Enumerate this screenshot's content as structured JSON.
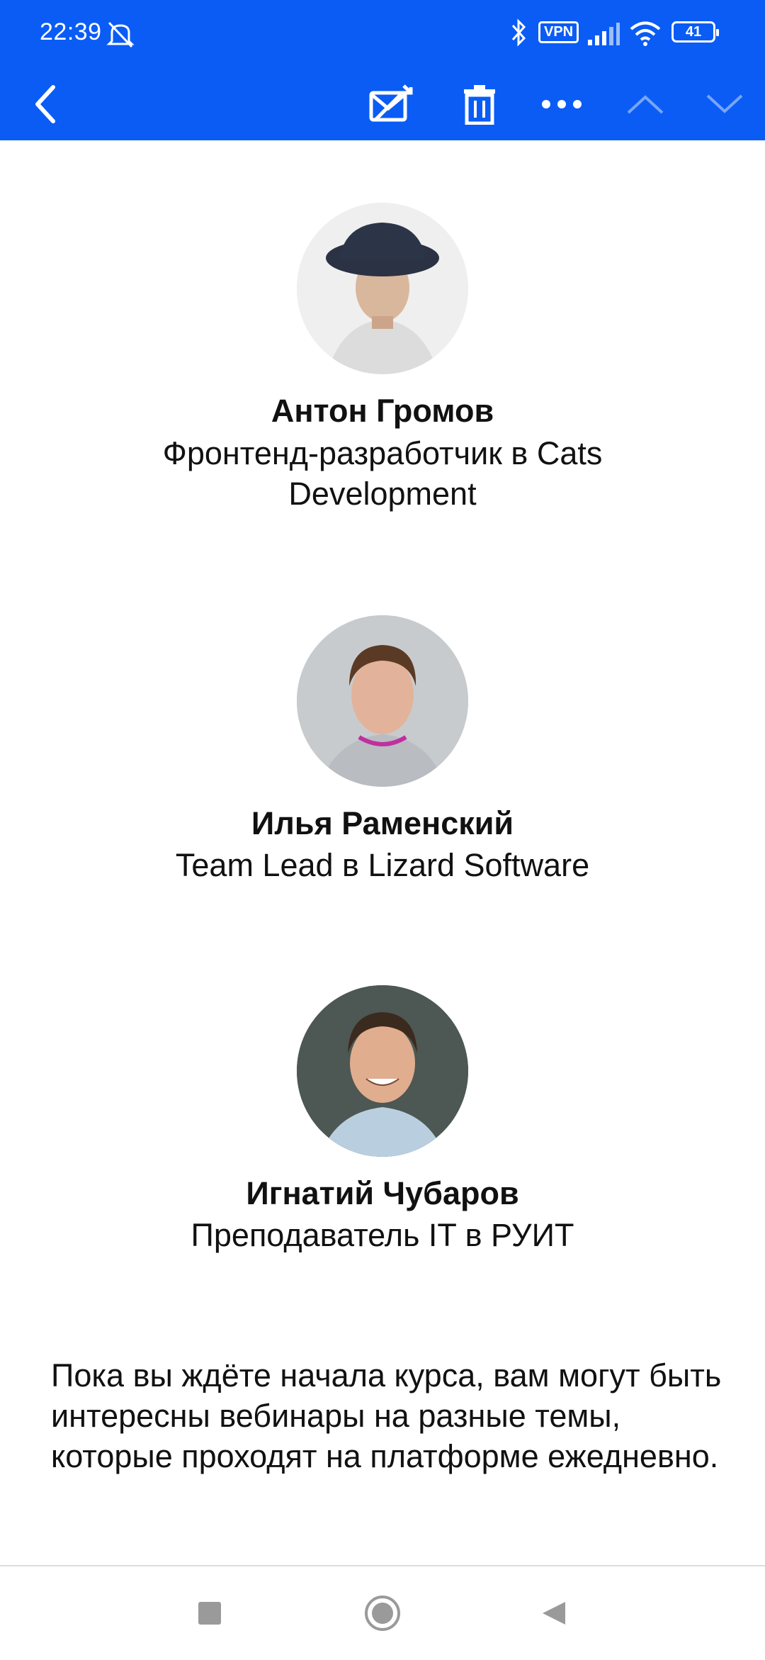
{
  "status_bar": {
    "time": "22:39",
    "icons": [
      "mute-alarm-icon",
      "bluetooth-icon",
      "vpn-icon",
      "signal-icon",
      "wifi-icon",
      "battery-icon"
    ],
    "vpn_label": "VPN",
    "battery_level": "41"
  },
  "toolbar": {
    "icons": [
      "back-icon",
      "mark-unread-icon",
      "trash-icon",
      "more-icon",
      "previous-icon",
      "next-icon"
    ]
  },
  "colors": {
    "app_bar": "#0a5cf5",
    "heading_accent": "#1ac8c8",
    "text": "#111111"
  },
  "speakers": [
    {
      "name": "Антон Громов",
      "role": "Фронтенд-разработчик в Cats Development"
    },
    {
      "name": "Илья Раменский",
      "role": "Team Lead в Lizard Software"
    },
    {
      "name": "Игнатий Чубаров",
      "role": "Преподаватель IT в РУИТ"
    }
  ],
  "body_text": "Пока вы ждёте начала курса, вам могут быть интересны вебинары на разные темы, которые проходят на платформе ежедневно.",
  "nav": {
    "icons": [
      "recents-icon",
      "home-icon",
      "back-triangle-icon"
    ]
  }
}
